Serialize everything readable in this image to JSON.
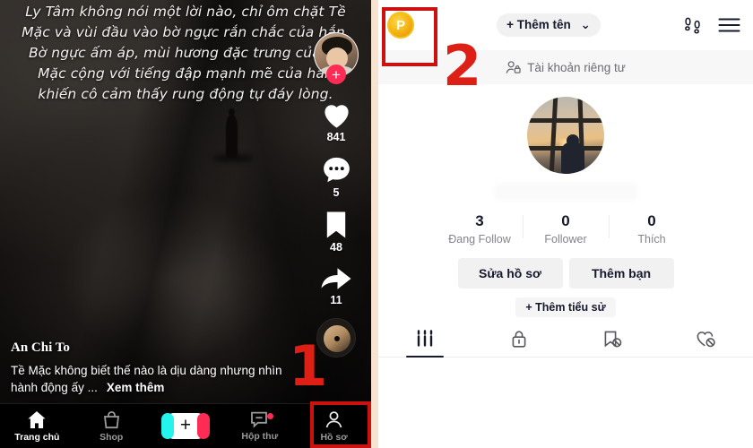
{
  "left_screen": {
    "video_overlay_text": "Ly Tâm không nói một lời nào, chỉ ôm chặt Tề Mặc và vùi đầu vào bờ ngực rắn chắc của hắn. Bờ ngực ấm áp, mùi hương đặc trưng của Tề Mặc cộng với tiếng đập mạnh mẽ của hắn khiến cô cảm thấy rung động tự đáy lòng.",
    "rail": {
      "follow_plus": "+",
      "like_count": "841",
      "comment_count": "5",
      "bookmark_count": "48",
      "share_count": "11",
      "avatar_name": "creator-avatar",
      "music_disc_name": "music-disc"
    },
    "caption": {
      "author": "An Chi To",
      "text": "Tề Mặc không biết thế nào là dịu dàng nhưng nhìn hành động ấy ...",
      "more_label": "Xem thêm"
    },
    "bottom_nav": [
      {
        "label": "Trang chủ",
        "icon": "home-icon",
        "active": true
      },
      {
        "label": "Shop",
        "icon": "shop-bag-icon",
        "active": false
      },
      {
        "label": "",
        "icon": "create-plus-icon",
        "active": false
      },
      {
        "label": "Hộp thư",
        "icon": "inbox-icon",
        "active": false,
        "badge": true
      },
      {
        "label": "Hồ sơ",
        "icon": "profile-person-icon",
        "active": false,
        "highlighted": true
      }
    ],
    "annotation": {
      "number": "1"
    }
  },
  "right_screen": {
    "header": {
      "coin_label": "P",
      "add_name_label": "+ Thêm tên",
      "chevron": "⌄",
      "footprints_icon": "footprints-icon",
      "menu_icon": "hamburger-menu-icon"
    },
    "private_account": {
      "label": "Tài khoản riêng tư",
      "icon": "person-lock-icon"
    },
    "profile": {
      "avatar_name": "profile-avatar",
      "username_hidden": ""
    },
    "stats": [
      {
        "value": "3",
        "label": "Đang Follow"
      },
      {
        "value": "0",
        "label": "Follower"
      },
      {
        "value": "0",
        "label": "Thích"
      }
    ],
    "buttons": {
      "edit_profile": "Sửa hồ sơ",
      "add_friend": "Thêm bạn",
      "add_bio": "+ Thêm tiểu sử"
    },
    "tabs": [
      {
        "icon": "grid-posts-icon",
        "active": true
      },
      {
        "icon": "lock-private-icon",
        "active": false
      },
      {
        "icon": "bookmark-slash-icon",
        "active": false
      },
      {
        "icon": "heart-slash-icon",
        "active": false
      }
    ],
    "annotation": {
      "number": "2"
    }
  },
  "colors": {
    "accent_red": "#fe2c55",
    "annotation_red": "#cc1111",
    "coin_gold": "#f5b716",
    "divider_peach": "#f8e3d0",
    "chip_grey": "#f1f1f2"
  }
}
